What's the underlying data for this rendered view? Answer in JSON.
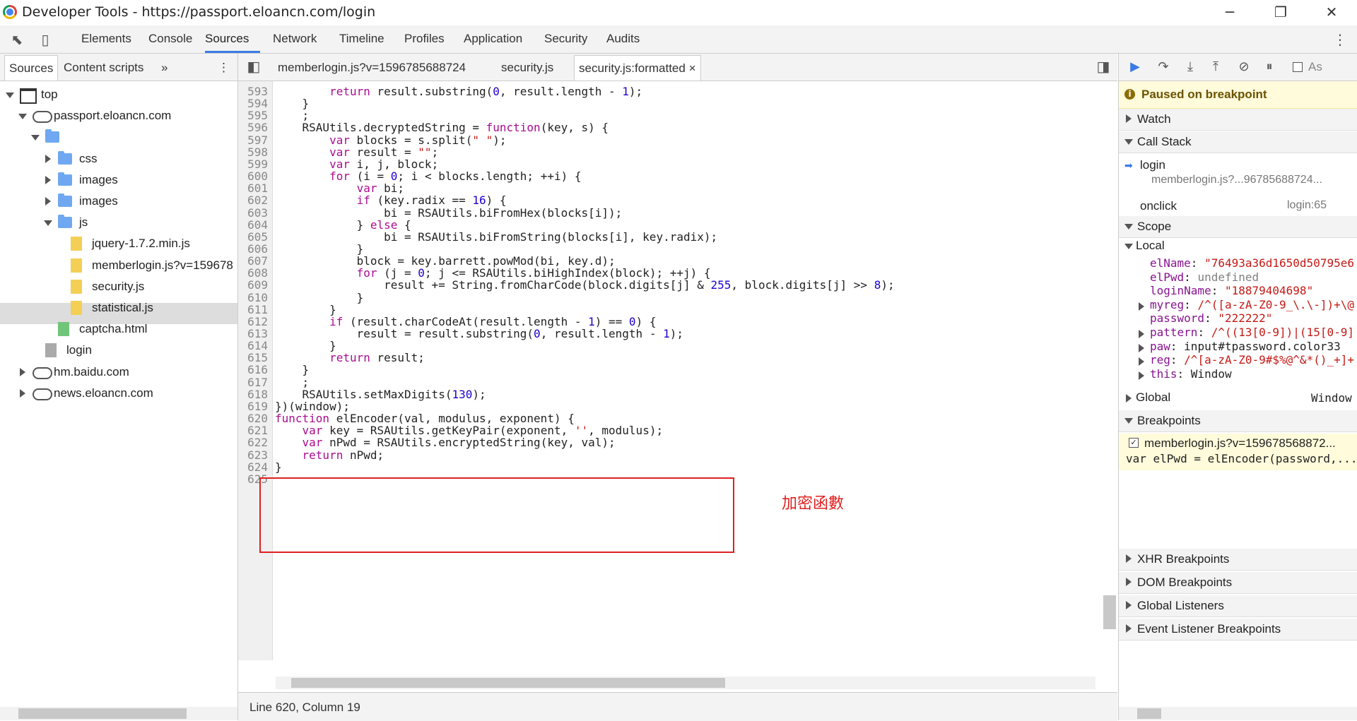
{
  "window": {
    "title": "Developer Tools - https://passport.eloancn.com/login"
  },
  "main_tabs": [
    "Elements",
    "Console",
    "Sources",
    "Network",
    "Timeline",
    "Profiles",
    "Application",
    "Security",
    "Audits"
  ],
  "active_main_tab": "Sources",
  "left_panel": {
    "tabs": [
      "Sources",
      "Content scripts"
    ],
    "tree": [
      {
        "label": "top",
        "depth": 0,
        "kind": "frame",
        "expanded": true
      },
      {
        "label": "passport.eloancn.com",
        "depth": 1,
        "kind": "cloud",
        "expanded": true
      },
      {
        "label": "",
        "depth": 2,
        "kind": "folder",
        "expanded": true
      },
      {
        "label": "css",
        "depth": 3,
        "kind": "folder",
        "expanded": false
      },
      {
        "label": "images",
        "depth": 3,
        "kind": "folder",
        "expanded": false
      },
      {
        "label": "images",
        "depth": 3,
        "kind": "folder",
        "expanded": false
      },
      {
        "label": "js",
        "depth": 3,
        "kind": "folder",
        "expanded": true
      },
      {
        "label": "jquery-1.7.2.min.js",
        "depth": 4,
        "kind": "file"
      },
      {
        "label": "memberlogin.js?v=159678",
        "depth": 4,
        "kind": "file",
        "selected": true
      },
      {
        "label": "security.js",
        "depth": 4,
        "kind": "file"
      },
      {
        "label": "statistical.js",
        "depth": 4,
        "kind": "file"
      },
      {
        "label": "captcha.html",
        "depth": 3,
        "kind": "file-green"
      },
      {
        "label": "login",
        "depth": 2,
        "kind": "file-gray"
      },
      {
        "label": "hm.baidu.com",
        "depth": 1,
        "kind": "cloud",
        "expanded": false
      },
      {
        "label": "news.eloancn.com",
        "depth": 1,
        "kind": "cloud",
        "expanded": false
      }
    ]
  },
  "editor": {
    "tabs": [
      "memberlogin.js?v=1596785688724",
      "security.js",
      "security.js:formatted"
    ],
    "active_tab": "security.js:formatted",
    "close_glyph": "×",
    "lines": [
      {
        "n": "593",
        "code": "        return result.substring(0, result.length - 1);"
      },
      {
        "n": "594",
        "code": "    }"
      },
      {
        "n": "595",
        "code": "    ;"
      },
      {
        "n": "596",
        "code": "    RSAUtils.decryptedString = function(key, s) {"
      },
      {
        "n": "597",
        "code": "        var blocks = s.split(\" \");"
      },
      {
        "n": "598",
        "code": "        var result = \"\";"
      },
      {
        "n": "599",
        "code": "        var i, j, block;"
      },
      {
        "n": "600",
        "code": "        for (i = 0; i < blocks.length; ++i) {"
      },
      {
        "n": "601",
        "code": "            var bi;"
      },
      {
        "n": "602",
        "code": "            if (key.radix == 16) {"
      },
      {
        "n": "603",
        "code": "                bi = RSAUtils.biFromHex(blocks[i]);"
      },
      {
        "n": "604",
        "code": "            } else {"
      },
      {
        "n": "605",
        "code": "                bi = RSAUtils.biFromString(blocks[i], key.radix);"
      },
      {
        "n": "606",
        "code": "            }"
      },
      {
        "n": "607",
        "code": "            block = key.barrett.powMod(bi, key.d);"
      },
      {
        "n": "608",
        "code": "            for (j = 0; j <= RSAUtils.biHighIndex(block); ++j) {"
      },
      {
        "n": "609",
        "code": "                result += String.fromCharCode(block.digits[j] & 255, block.digits[j] >> 8);"
      },
      {
        "n": "610",
        "code": "            }"
      },
      {
        "n": "611",
        "code": "        }"
      },
      {
        "n": "612",
        "code": "        if (result.charCodeAt(result.length - 1) == 0) {"
      },
      {
        "n": "613",
        "code": "            result = result.substring(0, result.length - 1);"
      },
      {
        "n": "614",
        "code": "        }"
      },
      {
        "n": "615",
        "code": "        return result;"
      },
      {
        "n": "616",
        "code": "    }"
      },
      {
        "n": "617",
        "code": "    ;"
      },
      {
        "n": "618",
        "code": "    RSAUtils.setMaxDigits(130);"
      },
      {
        "n": "619",
        "code": "})(window);"
      },
      {
        "n": "620",
        "code": "function elEncoder(val, modulus, exponent) {"
      },
      {
        "n": "621",
        "code": "    var key = RSAUtils.getKeyPair(exponent, '', modulus);"
      },
      {
        "n": "622",
        "code": "    var nPwd = RSAUtils.encryptedString(key, val);"
      },
      {
        "n": "623",
        "code": "    return nPwd;"
      },
      {
        "n": "624",
        "code": "}"
      },
      {
        "n": "625",
        "code": ""
      }
    ],
    "annotation": "加密函數",
    "status": "Line 620, Column 19"
  },
  "right_panel": {
    "paused_label": "Paused on breakpoint",
    "watch_label": "Watch",
    "callstack_label": "Call Stack",
    "callstack": [
      {
        "fn": "login",
        "loc": "memberlogin.js?...96785688724..."
      },
      {
        "fn": "onclick",
        "loc": "login:65"
      }
    ],
    "scope_label": "Scope",
    "local_label": "Local",
    "locals": [
      {
        "name": "elName",
        "value": "\"76493a36d1650d50795e6",
        "type": "string",
        "expandable": false
      },
      {
        "name": "elPwd",
        "value": "undefined",
        "type": "undef",
        "expandable": false
      },
      {
        "name": "loginName",
        "value": "\"18879404698\"",
        "type": "string",
        "expandable": false
      },
      {
        "name": "myreg",
        "value": "/^([a-zA-Z0-9_\\.\\-])+\\@",
        "type": "string",
        "expandable": true
      },
      {
        "name": "password",
        "value": "\"222222\"",
        "type": "string",
        "expandable": false
      },
      {
        "name": "pattern",
        "value": "/^((13[0-9])|(15[0-9]",
        "type": "string",
        "expandable": true
      },
      {
        "name": "paw",
        "value": "input#tpassword.color33",
        "type": "obj",
        "expandable": true
      },
      {
        "name": "reg",
        "value": "/^[a-zA-Z0-9#$%@^&*()_+]+",
        "type": "string",
        "expandable": true
      },
      {
        "name": "this",
        "value": "Window",
        "type": "obj",
        "expandable": true
      }
    ],
    "global_label": "Global",
    "global_value": "Window",
    "breakpoints_label": "Breakpoints",
    "breakpoint": {
      "file": "memberlogin.js?v=159678568872...",
      "code": "var elPwd = elEncoder(password,..."
    },
    "other_sections": [
      "XHR Breakpoints",
      "DOM Breakpoints",
      "Global Listeners",
      "Event Listener Breakpoints"
    ],
    "async_label": "As"
  },
  "colors": {
    "accent": "#3b7be4",
    "annotation": "#e02020",
    "keyword": "#aa0d91",
    "number": "#1c00cf",
    "string": "#c41a16"
  }
}
